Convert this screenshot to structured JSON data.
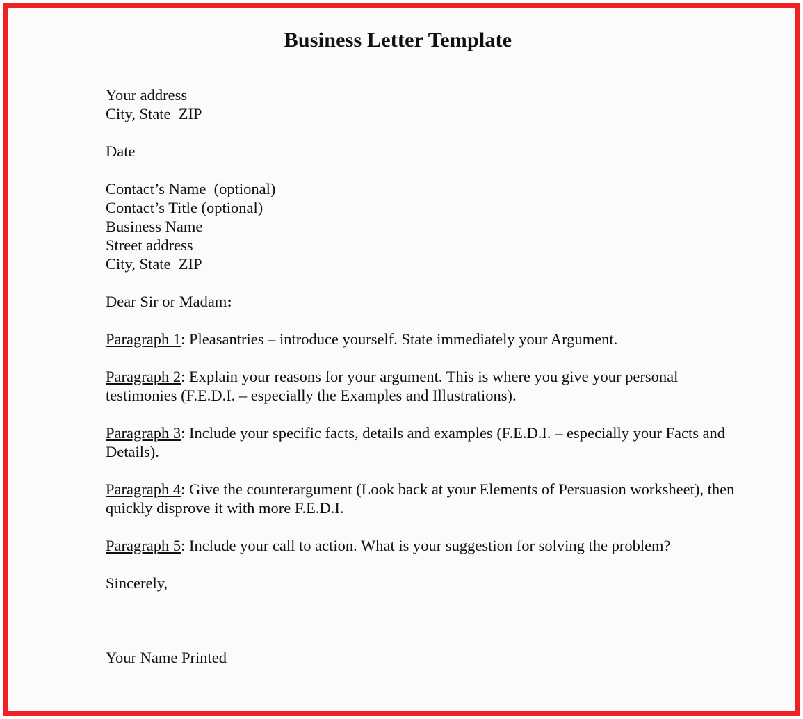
{
  "document": {
    "title": "Business Letter Template",
    "border_color": "#ee2222",
    "page_background": "#fbfbfb",
    "text_color": "#101010"
  },
  "sender_address": {
    "lines": [
      "Your address",
      "City, State  ZIP"
    ]
  },
  "date": {
    "label": "Date"
  },
  "recipient_address": {
    "lines": [
      "Contact’s Name  (optional)",
      "Contact’s Title (optional)",
      "Business Name",
      "Street address",
      "City, State  ZIP"
    ]
  },
  "salutation": {
    "text": "Dear Sir or Madam",
    "punctuation": ":"
  },
  "paragraphs": [
    {
      "label": "Paragraph 1",
      "separator": ":  ",
      "text": "Pleasantries – introduce yourself.  State immediately your Argument."
    },
    {
      "label": "Paragraph 2",
      "separator": ":  ",
      "text": "Explain your reasons for your argument.  This is where you give your personal testimonies (F.E.D.I. – especially the Examples and Illustrations)."
    },
    {
      "label": "Paragraph 3",
      "separator": ":  ",
      "text": "Include your specific facts, details and examples (F.E.D.I. – especially your Facts and Details)."
    },
    {
      "label": "Paragraph 4",
      "separator": ":  ",
      "text": "Give the counterargument (Look back at your Elements of Persuasion worksheet), then quickly disprove it with more F.E.D.I."
    },
    {
      "label": "Paragraph 5",
      "separator": ":  ",
      "text": "Include your call to action.  What is your suggestion for solving the problem?"
    }
  ],
  "closing": {
    "valediction": "Sincerely,",
    "printed_name": "Your Name Printed"
  }
}
